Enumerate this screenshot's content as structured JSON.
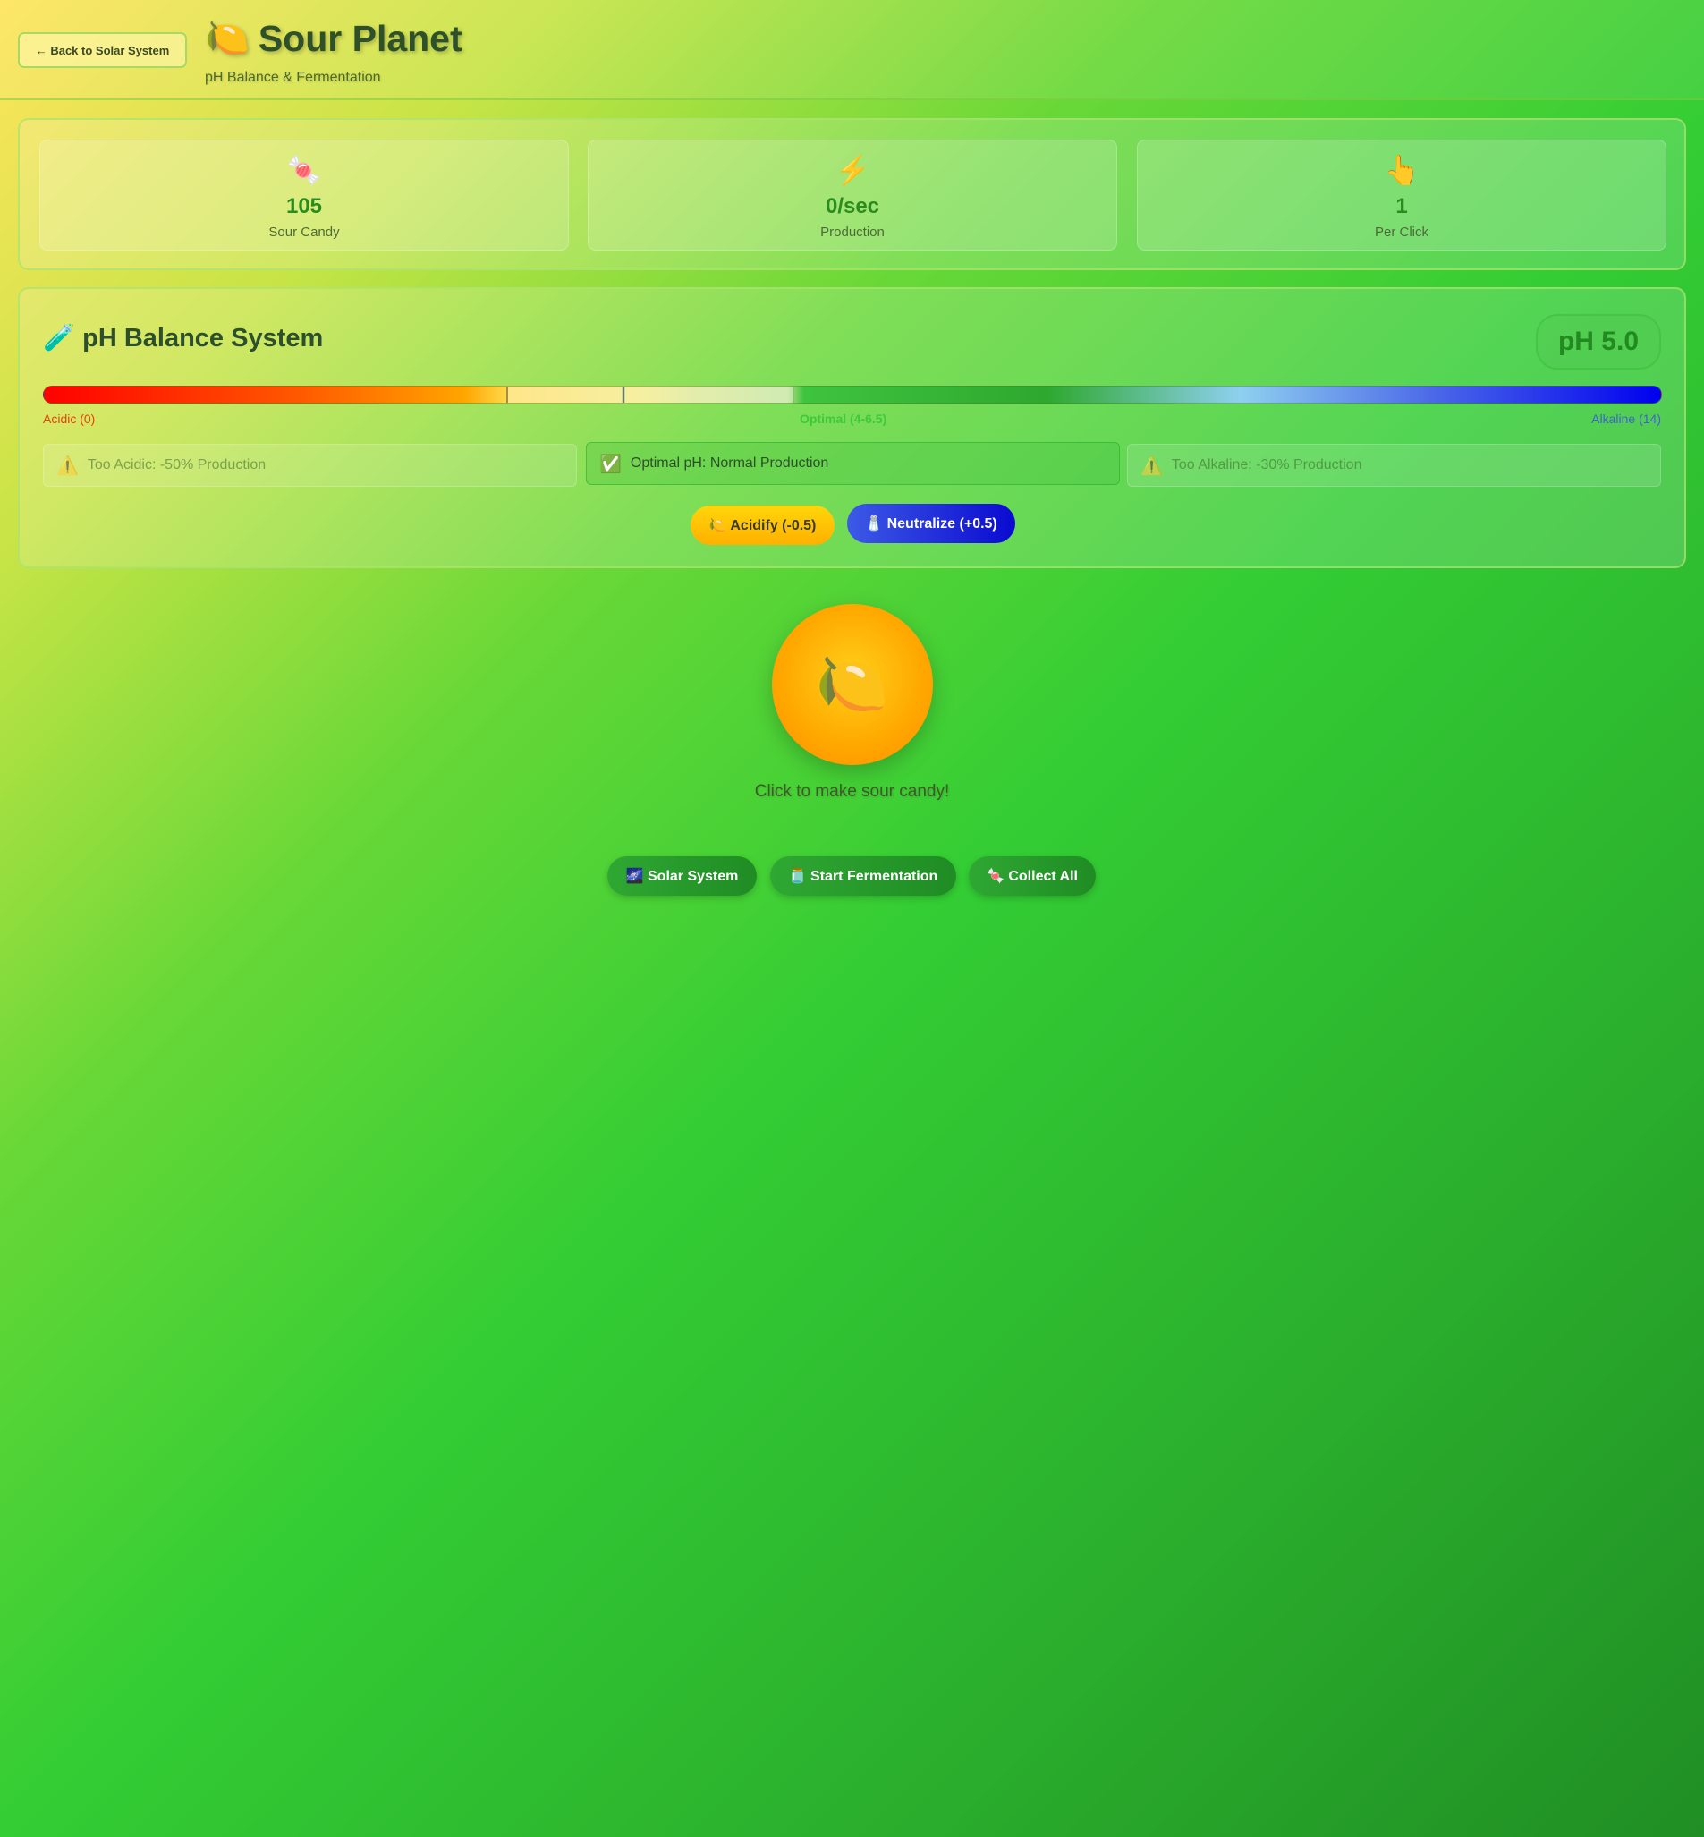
{
  "header": {
    "back_label": "← Back to Solar System",
    "title_icon": "🍋",
    "title": "Sour Planet",
    "subtitle": "pH Balance & Fermentation"
  },
  "stats": [
    {
      "icon": "🍬",
      "icon_name": "candy-icon",
      "value": "105",
      "label": "Sour Candy"
    },
    {
      "icon": "⚡",
      "icon_name": "lightning-icon",
      "value": "0/sec",
      "label": "Production"
    },
    {
      "icon": "👆",
      "icon_name": "pointing-finger-icon",
      "value": "1",
      "label": "Per Click"
    }
  ],
  "ph": {
    "title_icon": "🧪",
    "title": "pH Balance System",
    "current": "pH 5.0",
    "current_value": 5.0,
    "scale_min": 0,
    "scale_max": 14,
    "optimal_range": [
      4,
      6.5
    ],
    "label_acidic": "Acidic (0)",
    "label_optimal": "Optimal (4-6.5)",
    "label_alkaline": "Alkaline (14)",
    "status": {
      "acidic": {
        "icon": "⚠️",
        "text": "Too Acidic: -50% Production",
        "active": false
      },
      "optimal": {
        "icon": "✅",
        "text": "Optimal pH: Normal Production",
        "active": true
      },
      "alkaline": {
        "icon": "⚠️",
        "text": "Too Alkaline: -30% Production",
        "active": false
      }
    },
    "acidify_label": "🍋 Acidify (-0.5)",
    "neutralize_label": "🧂 Neutralize (+0.5)"
  },
  "clicker": {
    "icon": "🍋",
    "hint": "Click to make sour candy!"
  },
  "nav": {
    "solar_label": "🌌 Solar System",
    "ferment_label": "🫙 Start Fermentation",
    "collect_label": "🍬 Collect All"
  },
  "colors": {
    "accent_green": "#2b8c1e",
    "acid_red": "#ff0000",
    "alkaline_blue": "#0000ee",
    "acidify_yellow": "#ffd60a"
  }
}
